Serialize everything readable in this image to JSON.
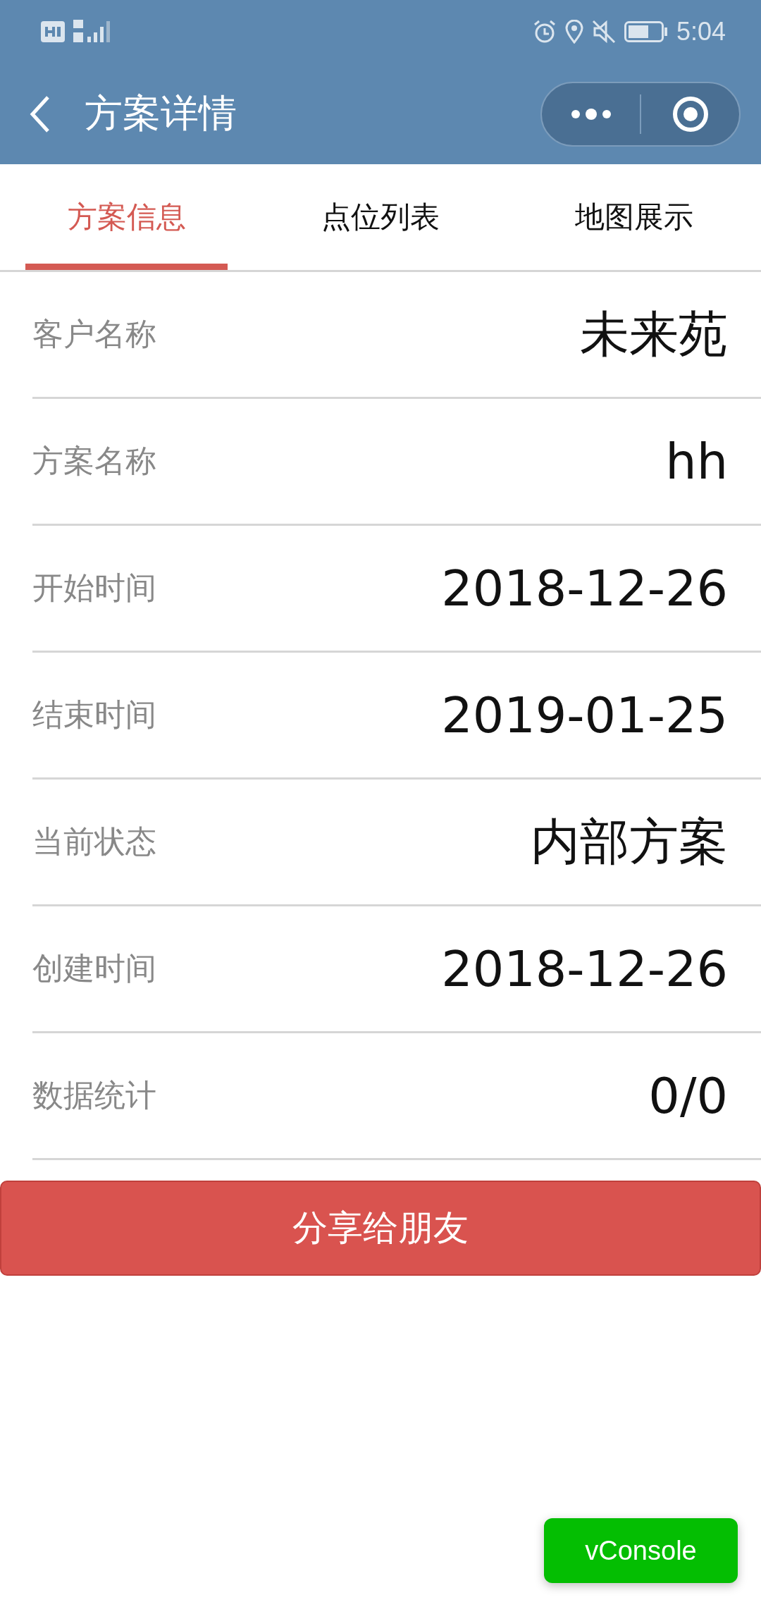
{
  "status_bar": {
    "time": "5:04"
  },
  "nav_bar": {
    "title": "方案详情"
  },
  "tabs": [
    {
      "label": "方案信息",
      "selected": true
    },
    {
      "label": "点位列表",
      "selected": false
    },
    {
      "label": "地图展示",
      "selected": false
    }
  ],
  "fields": [
    {
      "label": "客户名称",
      "value": "未来苑"
    },
    {
      "label": "方案名称",
      "value": "hh"
    },
    {
      "label": "开始时间",
      "value": "2018-12-26"
    },
    {
      "label": "结束时间",
      "value": "2019-01-25"
    },
    {
      "label": "当前状态",
      "value": "内部方案"
    },
    {
      "label": "创建时间",
      "value": "2018-12-26"
    },
    {
      "label": "数据统计",
      "value": "0/0"
    }
  ],
  "share_button": {
    "label": "分享给朋友"
  },
  "vconsole_button": {
    "label": "vConsole"
  }
}
